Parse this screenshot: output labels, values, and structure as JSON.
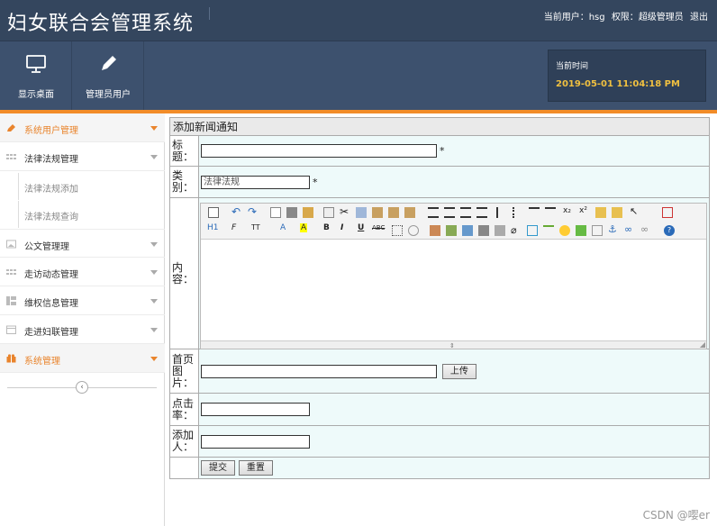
{
  "app": {
    "title": "妇女联合会管理系统"
  },
  "header": {
    "user_prefix": "当前用户：",
    "user": "hsg",
    "role_prefix": "权限：",
    "role": "超级管理员",
    "logout": "退出"
  },
  "toolbar": {
    "desktop": "显示桌面",
    "admin_users": "管理员用户"
  },
  "time": {
    "label": "当前时间",
    "value": "2019-05-01 11:04:18 PM"
  },
  "sidebar": {
    "items": [
      {
        "label": "系统用户管理",
        "icon": "pencil-icon"
      },
      {
        "label": "法律法规管理",
        "icon": "grid-icon"
      },
      {
        "label": "法律法规添加"
      },
      {
        "label": "法律法规查询"
      },
      {
        "label": "公文管理理",
        "icon": "image-icon"
      },
      {
        "label": "走访动态管理",
        "icon": "grid-icon"
      },
      {
        "label": "维权信息管理",
        "icon": "layout-icon"
      },
      {
        "label": "走进妇联管理",
        "icon": "calendar-icon"
      },
      {
        "label": "系统管理",
        "icon": "gift-icon"
      }
    ],
    "collapse": "‹"
  },
  "form": {
    "heading": "添加新闻通知",
    "title_label": "标题：",
    "category_label": "类别：",
    "category_value": "法律法规",
    "content_label": "内容：",
    "image_label": "首页图片：",
    "upload": "上传",
    "clicks_label": "点击率：",
    "adder_label": "添加人：",
    "submit": "提交",
    "reset": "重置",
    "required": "*"
  },
  "editor": {
    "heading_btn": "H1",
    "font_btn": "F",
    "size_btn": "TT",
    "color_btn": "A",
    "bg_btn": "A",
    "bold": "B",
    "italic": "I",
    "underline": "U",
    "strike": "ABC",
    "help": "?"
  },
  "watermark": "CSDN @嘤er"
}
